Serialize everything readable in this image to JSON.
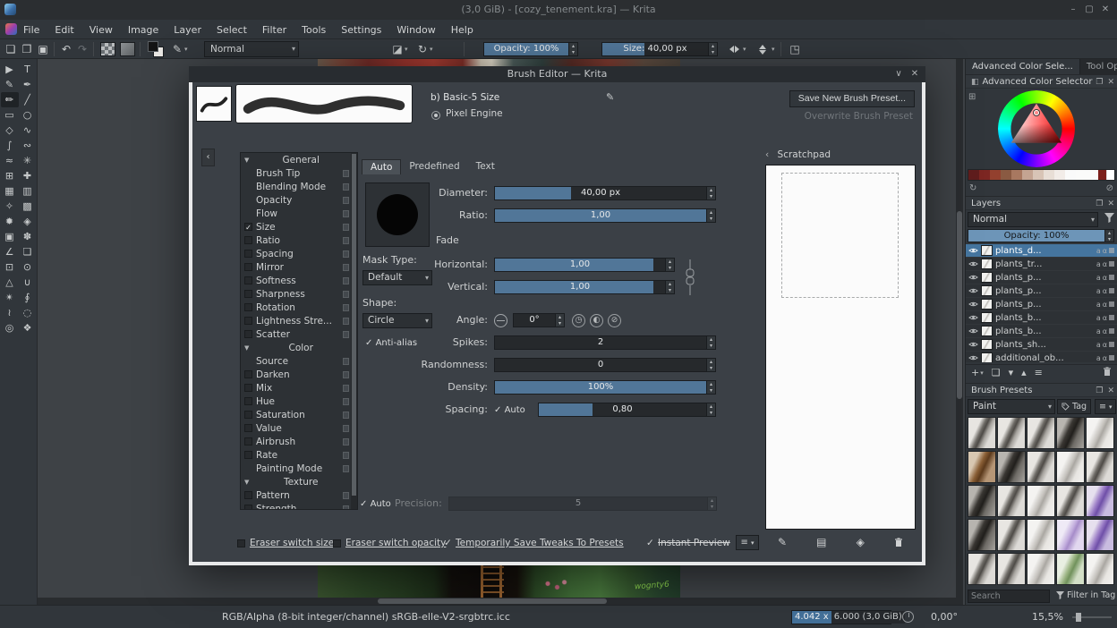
{
  "window": {
    "title": "(3,0 GiB) - [cozy_tenement.kra] — Krita"
  },
  "icons": {
    "minimize": "–",
    "maximize": "▢",
    "close": "✕",
    "new_doc": "❏",
    "open_doc": "❐",
    "save_doc": "▣",
    "undo": "↶",
    "redo": "↷",
    "eraser": "◪",
    "reload": "↻",
    "dropdown": "▾",
    "spin_up": "▴",
    "spin_down": "▾",
    "edit": "✎",
    "back": "‹",
    "collapse": "‹",
    "chevron_down": "∨",
    "menu": "≡",
    "settings": "⊞",
    "refresh": "↻",
    "clear": "⊘",
    "clock": "◷",
    "half": "◐",
    "slash": "⊘",
    "plus": "+",
    "duplicate": "❏",
    "up": "▴",
    "down": "▾",
    "props": "≡",
    "scratch_brush": "✎",
    "scratch_card": "▤",
    "scratch_fill": "◈",
    "trim": "◳",
    "colorsel_header": "◧",
    "section_arrow": "▼"
  },
  "menubar": {
    "items": [
      "File",
      "Edit",
      "View",
      "Image",
      "Layer",
      "Select",
      "Filter",
      "Tools",
      "Settings",
      "Window",
      "Help"
    ]
  },
  "toolbar": {
    "blending_label": "Normal",
    "opacity": {
      "label": "Opacity: 100%",
      "fill": 100
    },
    "size": {
      "label": "Size: 40,00 px",
      "fill": 40
    }
  },
  "toolbox": [
    {
      "glyph": "▶",
      "name": "tool-select-shapes"
    },
    {
      "glyph": "T",
      "name": "tool-text"
    },
    {
      "glyph": "✎",
      "name": "tool-edit-shapes"
    },
    {
      "glyph": "✒",
      "name": "tool-calligraphy"
    },
    {
      "glyph": "✏",
      "name": "tool-freehand-brush",
      "selected": true
    },
    {
      "glyph": "╱",
      "name": "tool-line"
    },
    {
      "glyph": "▭",
      "name": "tool-rectangle"
    },
    {
      "glyph": "○",
      "name": "tool-ellipse"
    },
    {
      "glyph": "◇",
      "name": "tool-polygon"
    },
    {
      "glyph": "∿",
      "name": "tool-polyline"
    },
    {
      "glyph": "∫",
      "name": "tool-bezier-curve"
    },
    {
      "glyph": "∾",
      "name": "tool-freehand-path"
    },
    {
      "glyph": "≈",
      "name": "tool-dynamic-brush"
    },
    {
      "glyph": "✳",
      "name": "tool-multibrush"
    },
    {
      "glyph": "⊞",
      "name": "tool-transform"
    },
    {
      "glyph": "✚",
      "name": "tool-move"
    },
    {
      "glyph": "▦",
      "name": "tool-crop"
    },
    {
      "glyph": "▥",
      "name": "tool-gradient"
    },
    {
      "glyph": "✧",
      "name": "tool-color-sampler"
    },
    {
      "glyph": "▩",
      "name": "tool-pattern-edit"
    },
    {
      "glyph": "✹",
      "name": "tool-smart-patch"
    },
    {
      "glyph": "◈",
      "name": "tool-fill"
    },
    {
      "glyph": "▣",
      "name": "tool-enclose-fill"
    },
    {
      "glyph": "✽",
      "name": "tool-colorize-mask"
    },
    {
      "glyph": "∠",
      "name": "tool-measure"
    },
    {
      "glyph": "❏",
      "name": "tool-reference-images"
    },
    {
      "glyph": "⊡",
      "name": "tool-rect-select"
    },
    {
      "glyph": "⊙",
      "name": "tool-ellipse-select"
    },
    {
      "glyph": "△",
      "name": "tool-polygon-select"
    },
    {
      "glyph": "∪",
      "name": "tool-freehand-select"
    },
    {
      "glyph": "✴",
      "name": "tool-similar-select"
    },
    {
      "glyph": "∮",
      "name": "tool-bezier-select"
    },
    {
      "glyph": "≀",
      "name": "tool-magnetic-select"
    },
    {
      "glyph": "◌",
      "name": "tool-assistants"
    },
    {
      "glyph": "◎",
      "name": "tool-zoom"
    },
    {
      "glyph": "❖",
      "name": "tool-pan"
    }
  ],
  "canvas": {
    "signature": "wognty6"
  },
  "dialog": {
    "title": "Brush Editor — Krita",
    "preset_name": "b) Basic-5 Size",
    "engine": "Pixel Engine",
    "save_new": "Save New Brush Preset...",
    "overwrite": "Overwrite Brush Preset",
    "scratchpad_title": "Scratchpad",
    "tabs": [
      {
        "label": "Auto",
        "selected": true
      },
      {
        "label": "Predefined",
        "selected": false
      },
      {
        "label": "Text",
        "selected": false
      }
    ],
    "options": [
      {
        "label": "General",
        "type": "section"
      },
      {
        "label": "Brush Tip",
        "type": "plain"
      },
      {
        "label": "Blending Mode",
        "type": "plain"
      },
      {
        "label": "Opacity",
        "type": "plain"
      },
      {
        "label": "Flow",
        "type": "plain"
      },
      {
        "label": "Size",
        "type": "check",
        "checked": true
      },
      {
        "label": "Ratio",
        "type": "check",
        "checked": false
      },
      {
        "label": "Spacing",
        "type": "check",
        "checked": false
      },
      {
        "label": "Mirror",
        "type": "check",
        "checked": false
      },
      {
        "label": "Softness",
        "type": "check",
        "checked": false
      },
      {
        "label": "Sharpness",
        "type": "check",
        "checked": false
      },
      {
        "label": "Rotation",
        "type": "check",
        "checked": false
      },
      {
        "label": "Lightness Stre...",
        "type": "check",
        "checked": false
      },
      {
        "label": "Scatter",
        "type": "check",
        "checked": false
      },
      {
        "label": "Color",
        "type": "section"
      },
      {
        "label": "Source",
        "type": "plain"
      },
      {
        "label": "Darken",
        "type": "check",
        "checked": false
      },
      {
        "label": "Mix",
        "type": "check",
        "checked": false
      },
      {
        "label": "Hue",
        "type": "check",
        "checked": false
      },
      {
        "label": "Saturation",
        "type": "check",
        "checked": false
      },
      {
        "label": "Value",
        "type": "check",
        "checked": false
      },
      {
        "label": "Airbrush",
        "type": "check",
        "checked": false
      },
      {
        "label": "Rate",
        "type": "check",
        "checked": false
      },
      {
        "label": "Painting Mode",
        "type": "plain"
      },
      {
        "label": "Texture",
        "type": "section"
      },
      {
        "label": "Pattern",
        "type": "check",
        "checked": false
      },
      {
        "label": "Strength",
        "type": "check",
        "checked": false
      }
    ],
    "params": {
      "diameter_label": "Diameter:",
      "diameter": "40,00 px",
      "ratio_label": "Ratio:",
      "ratio": "1,00",
      "fade": "Fade",
      "horizontal_label": "Horizontal:",
      "horizontal": "1,00",
      "vertical_label": "Vertical:",
      "vertical": "1,00",
      "mask_type_label": "Mask Type:",
      "mask_type": "Default",
      "shape_label": "Shape:",
      "shape": "Circle",
      "angle_label": "Angle:",
      "angle": "0°",
      "antialias": "Anti-alias",
      "spikes_label": "Spikes:",
      "spikes": "2",
      "randomness_label": "Randomness:",
      "randomness": "0",
      "density_label": "Density:",
      "density": "100%",
      "spacing_label": "Spacing:",
      "spacing_auto": "Auto",
      "spacing": "0,80",
      "auto_label": "Auto",
      "precision_label": "Precision:",
      "precision": "5"
    },
    "footer": {
      "eraser_switch_size": "Eraser switch size",
      "eraser_switch_opacity": "Eraser switch opacity",
      "save_tweaks": "Temporarily Save Tweaks To Presets",
      "instant_preview": "Instant Preview"
    }
  },
  "dockers": {
    "tabs": [
      {
        "label": "Advanced Color Sele...",
        "selected": true
      },
      {
        "label": "Tool Opt...",
        "selected": false
      }
    ],
    "color_selector": {
      "title": "Advanced Color Selector",
      "history": [
        "#5f1d1d",
        "#7c2622",
        "#93402e",
        "#8a5a42",
        "#a87860",
        "#c4a492",
        "#d8c4b6",
        "#e8ded6",
        "#f2ece8",
        "#fafafa"
      ]
    },
    "layers": {
      "title": "Layers",
      "blending": "Normal",
      "opacity_label": "Opacity: 100%",
      "items": [
        {
          "name": "plants_d...",
          "selected": true
        },
        {
          "name": "plants_tr...",
          "selected": false
        },
        {
          "name": "plants_p...",
          "selected": false
        },
        {
          "name": "plants_p...",
          "selected": false
        },
        {
          "name": "plants_p...",
          "selected": false
        },
        {
          "name": "plants_b...",
          "selected": false
        },
        {
          "name": "plants_b...",
          "selected": false
        },
        {
          "name": "plants_sh...",
          "selected": false
        },
        {
          "name": "additional_ob...",
          "selected": false
        }
      ]
    },
    "brush_presets": {
      "title": "Brush Presets",
      "filter_value": "Paint",
      "tag_label": "Tag",
      "search_placeholder": "Search",
      "filter_in_tag": "Filter in Tag",
      "tiles": [
        "g",
        "g",
        "g",
        "d",
        "l",
        "b",
        "d",
        "g",
        "l",
        "g",
        "d",
        "g",
        "l",
        "g",
        "p",
        "d",
        "g",
        "l",
        "v",
        "p",
        "g",
        "g",
        "l",
        "n",
        "l"
      ]
    }
  },
  "statusbar": {
    "color_profile": "RGB/Alpha (8-bit integer/channel)  sRGB-elle-V2-srgbtrc.icc",
    "mem_left": "4.042 x",
    "mem_right": "6.000 (3,0 GiB)",
    "angle": "0,00°",
    "zoom": "15,5%"
  }
}
